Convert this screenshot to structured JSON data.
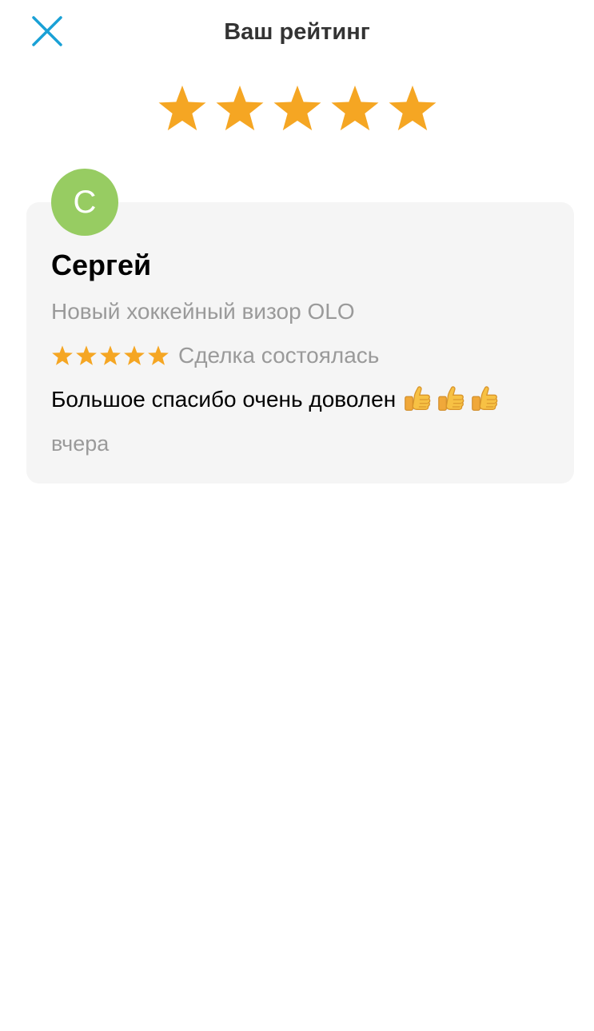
{
  "header": {
    "close_icon": "close-icon",
    "title": "Ваш рейтинг"
  },
  "rating": {
    "value": 5,
    "max": 5,
    "star_color": "#f5a623"
  },
  "review": {
    "avatar_letter": "С",
    "avatar_color": "#97cc62",
    "name": "Сергей",
    "item": "Новый хоккейный визор OLO",
    "stars": 5,
    "status": "Сделка состоялась",
    "text": "Большое спасибо очень доволен",
    "emoji": [
      "thumbs-up-icon",
      "thumbs-up-icon",
      "thumbs-up-icon"
    ],
    "date": "вчера"
  },
  "colors": {
    "accent": "#1aa1d6",
    "card_background": "#f5f5f5",
    "secondary_text": "#9a9a9a"
  }
}
